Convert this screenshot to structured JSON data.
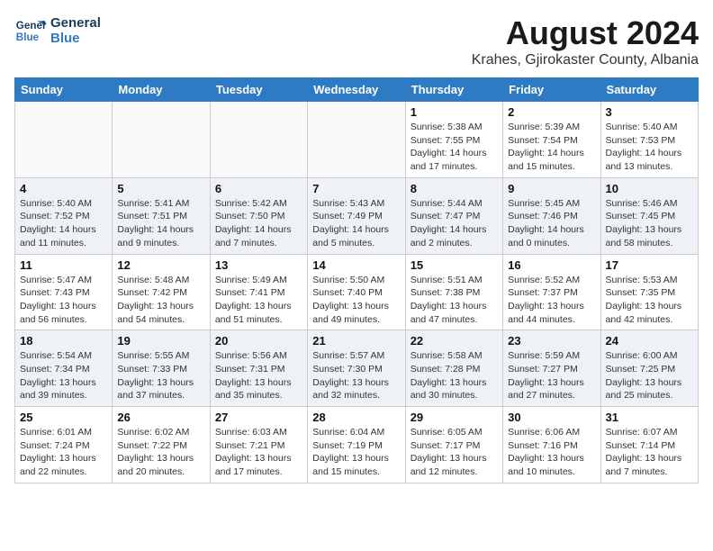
{
  "logo": {
    "line1": "General",
    "line2": "Blue"
  },
  "title": "August 2024",
  "subtitle": "Krahes, Gjirokaster County, Albania",
  "days_of_week": [
    "Sunday",
    "Monday",
    "Tuesday",
    "Wednesday",
    "Thursday",
    "Friday",
    "Saturday"
  ],
  "weeks": [
    [
      {
        "day": "",
        "info": ""
      },
      {
        "day": "",
        "info": ""
      },
      {
        "day": "",
        "info": ""
      },
      {
        "day": "",
        "info": ""
      },
      {
        "day": "1",
        "info": "Sunrise: 5:38 AM\nSunset: 7:55 PM\nDaylight: 14 hours\nand 17 minutes."
      },
      {
        "day": "2",
        "info": "Sunrise: 5:39 AM\nSunset: 7:54 PM\nDaylight: 14 hours\nand 15 minutes."
      },
      {
        "day": "3",
        "info": "Sunrise: 5:40 AM\nSunset: 7:53 PM\nDaylight: 14 hours\nand 13 minutes."
      }
    ],
    [
      {
        "day": "4",
        "info": "Sunrise: 5:40 AM\nSunset: 7:52 PM\nDaylight: 14 hours\nand 11 minutes."
      },
      {
        "day": "5",
        "info": "Sunrise: 5:41 AM\nSunset: 7:51 PM\nDaylight: 14 hours\nand 9 minutes."
      },
      {
        "day": "6",
        "info": "Sunrise: 5:42 AM\nSunset: 7:50 PM\nDaylight: 14 hours\nand 7 minutes."
      },
      {
        "day": "7",
        "info": "Sunrise: 5:43 AM\nSunset: 7:49 PM\nDaylight: 14 hours\nand 5 minutes."
      },
      {
        "day": "8",
        "info": "Sunrise: 5:44 AM\nSunset: 7:47 PM\nDaylight: 14 hours\nand 2 minutes."
      },
      {
        "day": "9",
        "info": "Sunrise: 5:45 AM\nSunset: 7:46 PM\nDaylight: 14 hours\nand 0 minutes."
      },
      {
        "day": "10",
        "info": "Sunrise: 5:46 AM\nSunset: 7:45 PM\nDaylight: 13 hours\nand 58 minutes."
      }
    ],
    [
      {
        "day": "11",
        "info": "Sunrise: 5:47 AM\nSunset: 7:43 PM\nDaylight: 13 hours\nand 56 minutes."
      },
      {
        "day": "12",
        "info": "Sunrise: 5:48 AM\nSunset: 7:42 PM\nDaylight: 13 hours\nand 54 minutes."
      },
      {
        "day": "13",
        "info": "Sunrise: 5:49 AM\nSunset: 7:41 PM\nDaylight: 13 hours\nand 51 minutes."
      },
      {
        "day": "14",
        "info": "Sunrise: 5:50 AM\nSunset: 7:40 PM\nDaylight: 13 hours\nand 49 minutes."
      },
      {
        "day": "15",
        "info": "Sunrise: 5:51 AM\nSunset: 7:38 PM\nDaylight: 13 hours\nand 47 minutes."
      },
      {
        "day": "16",
        "info": "Sunrise: 5:52 AM\nSunset: 7:37 PM\nDaylight: 13 hours\nand 44 minutes."
      },
      {
        "day": "17",
        "info": "Sunrise: 5:53 AM\nSunset: 7:35 PM\nDaylight: 13 hours\nand 42 minutes."
      }
    ],
    [
      {
        "day": "18",
        "info": "Sunrise: 5:54 AM\nSunset: 7:34 PM\nDaylight: 13 hours\nand 39 minutes."
      },
      {
        "day": "19",
        "info": "Sunrise: 5:55 AM\nSunset: 7:33 PM\nDaylight: 13 hours\nand 37 minutes."
      },
      {
        "day": "20",
        "info": "Sunrise: 5:56 AM\nSunset: 7:31 PM\nDaylight: 13 hours\nand 35 minutes."
      },
      {
        "day": "21",
        "info": "Sunrise: 5:57 AM\nSunset: 7:30 PM\nDaylight: 13 hours\nand 32 minutes."
      },
      {
        "day": "22",
        "info": "Sunrise: 5:58 AM\nSunset: 7:28 PM\nDaylight: 13 hours\nand 30 minutes."
      },
      {
        "day": "23",
        "info": "Sunrise: 5:59 AM\nSunset: 7:27 PM\nDaylight: 13 hours\nand 27 minutes."
      },
      {
        "day": "24",
        "info": "Sunrise: 6:00 AM\nSunset: 7:25 PM\nDaylight: 13 hours\nand 25 minutes."
      }
    ],
    [
      {
        "day": "25",
        "info": "Sunrise: 6:01 AM\nSunset: 7:24 PM\nDaylight: 13 hours\nand 22 minutes."
      },
      {
        "day": "26",
        "info": "Sunrise: 6:02 AM\nSunset: 7:22 PM\nDaylight: 13 hours\nand 20 minutes."
      },
      {
        "day": "27",
        "info": "Sunrise: 6:03 AM\nSunset: 7:21 PM\nDaylight: 13 hours\nand 17 minutes."
      },
      {
        "day": "28",
        "info": "Sunrise: 6:04 AM\nSunset: 7:19 PM\nDaylight: 13 hours\nand 15 minutes."
      },
      {
        "day": "29",
        "info": "Sunrise: 6:05 AM\nSunset: 7:17 PM\nDaylight: 13 hours\nand 12 minutes."
      },
      {
        "day": "30",
        "info": "Sunrise: 6:06 AM\nSunset: 7:16 PM\nDaylight: 13 hours\nand 10 minutes."
      },
      {
        "day": "31",
        "info": "Sunrise: 6:07 AM\nSunset: 7:14 PM\nDaylight: 13 hours\nand 7 minutes."
      }
    ]
  ]
}
